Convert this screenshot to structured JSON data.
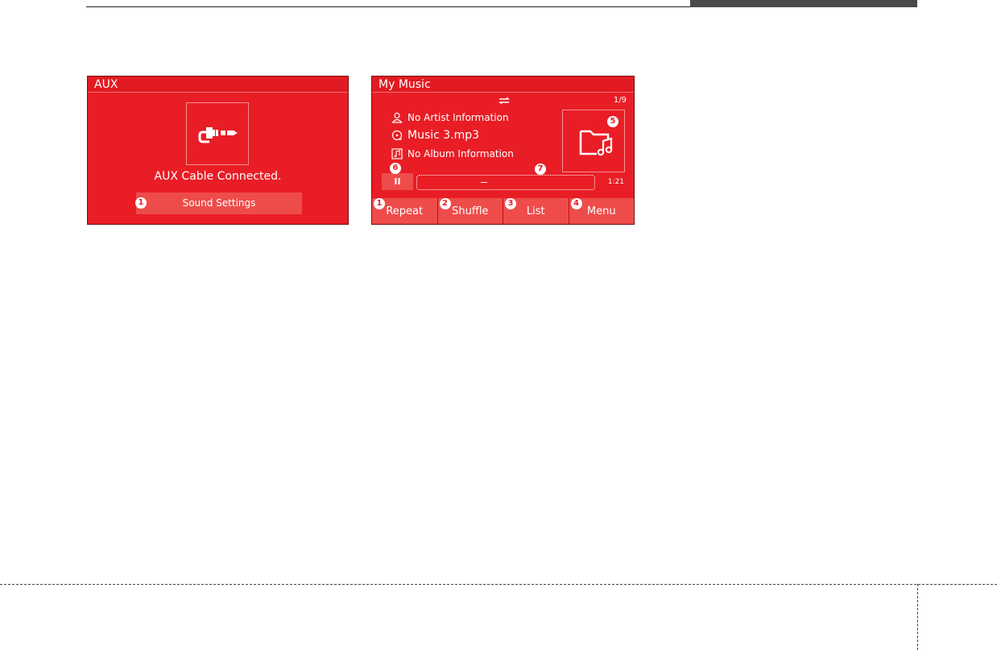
{
  "aux_screen": {
    "title": "AUX",
    "status": "AUX Cable Connected.",
    "sound_settings_label": "Sound Settings",
    "callout": "1",
    "art_icon": "aux-plug-icon"
  },
  "music_screen": {
    "title": "My Music",
    "repeat_icon": "repeat-icon",
    "track_counter": "1/9",
    "artist": "No Artist Information",
    "track_title": "Music 3.mp3",
    "album": "No Album Information",
    "album_art_icon": "folder-music-icon",
    "pause_label": "II",
    "elapsed": "1:21",
    "progress": 0.36,
    "callouts": {
      "album_art": "5",
      "pause": "6",
      "progress": "7"
    },
    "softkeys": [
      {
        "label": "Repeat",
        "callout": "1"
      },
      {
        "label": "Shuffle",
        "callout": "2"
      },
      {
        "label": "List",
        "callout": "3"
      },
      {
        "label": "Menu",
        "callout": "4"
      }
    ]
  },
  "colors": {
    "screen_bg": "#e91d25",
    "button_bg": "#ee4c4b",
    "text": "#ffffff"
  }
}
